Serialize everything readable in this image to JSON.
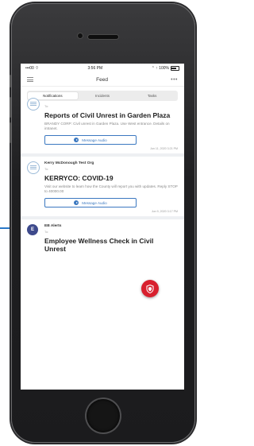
{
  "status_bar": {
    "carrier": "•••00 ⌔",
    "time": "3:56 PM",
    "battery": "⌃ ↑ 100%"
  },
  "nav": {
    "title": "Feed",
    "more": "•••"
  },
  "tabs": [
    {
      "label": "Notifications",
      "active": true
    },
    {
      "label": "Incidents",
      "active": false
    },
    {
      "label": "Tasks",
      "active": false
    }
  ],
  "cards": [
    {
      "sender": "",
      "to": "To:",
      "title": "Reports of Civil Unrest in Garden Plaza",
      "description": "BRANDY CORP: Civil unrest in Garden Plaza. Use West entrance. Details on intranet.",
      "button": "Message Audio",
      "timestamp": "Jun 11, 2020 3:21 PM"
    },
    {
      "sender": "Kerry McDonough Test Org",
      "to": "To:",
      "title": "KERRYCO: COVID-19",
      "description": "Visit our website to learn how the County will report you with updates. Reply STOP to 40000.00",
      "button": "Message Audio",
      "timestamp": "Jun 9, 2020 3:17 PM"
    },
    {
      "avatar_letter": "E",
      "sender": "EB Alerts",
      "to": "To:",
      "title": "Employee Wellness Check in Civil Unrest"
    }
  ],
  "colors": {
    "accent": "#3b78c0",
    "fab": "#d8202e",
    "avatar": "#3e4a8c"
  }
}
